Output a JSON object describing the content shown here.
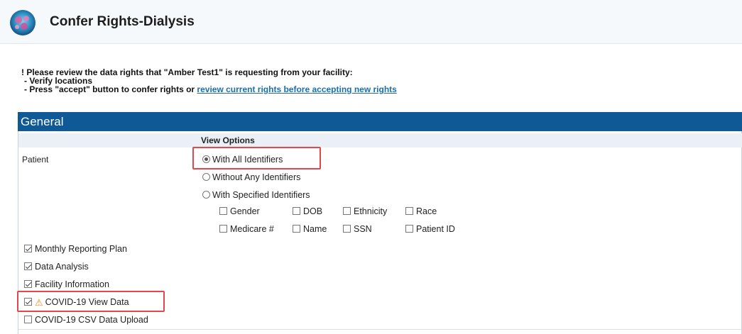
{
  "header": {
    "title": "Confer Rights-Dialysis"
  },
  "notice": {
    "line1": "! Please review the data rights that \"Amber Test1\" is requesting from your facility:",
    "line2": "- Verify locations",
    "line3_prefix": "- Press \"accept\" button to confer rights or ",
    "line3_link": "review current rights before accepting new rights"
  },
  "panel": {
    "title": "General",
    "view_options_header": "View Options",
    "patient_label": "Patient",
    "radio_options": [
      {
        "label": "With All Identifiers",
        "selected": true
      },
      {
        "label": "Without Any Identifiers",
        "selected": false
      },
      {
        "label": "With Specified Identifiers",
        "selected": false
      }
    ],
    "identifiers": [
      {
        "label": "Gender",
        "checked": false
      },
      {
        "label": "DOB",
        "checked": false
      },
      {
        "label": "Ethnicity",
        "checked": false
      },
      {
        "label": "Race",
        "checked": false
      },
      {
        "label": "Medicare #",
        "checked": false
      },
      {
        "label": "Name",
        "checked": false
      },
      {
        "label": "SSN",
        "checked": false
      },
      {
        "label": "Patient ID",
        "checked": false
      }
    ],
    "rights": [
      {
        "label": "Monthly Reporting Plan",
        "checked": true,
        "warning": false
      },
      {
        "label": "Data Analysis",
        "checked": true,
        "warning": false
      },
      {
        "label": "Facility Information",
        "checked": true,
        "warning": false
      },
      {
        "label": "COVID-19 View Data",
        "checked": true,
        "warning": true
      },
      {
        "label": "COVID-19 CSV Data Upload",
        "checked": false,
        "warning": false
      }
    ]
  },
  "colors": {
    "panel_header": "#0f5a96",
    "link": "#1a6fb0",
    "highlight": "#e0484c",
    "warning": "#e88a1a"
  }
}
